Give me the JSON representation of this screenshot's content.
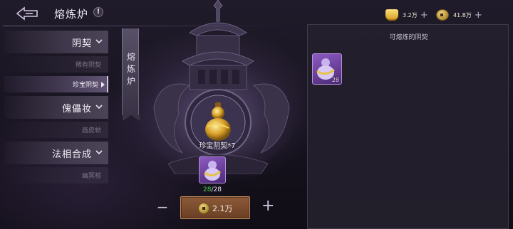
{
  "header": {
    "title": "熔炼炉",
    "info_mark": "!",
    "currencies": [
      {
        "icon": "gold-ingot-icon",
        "amount": "3.2万",
        "plus": "+"
      },
      {
        "icon": "copper-coin-icon",
        "amount": "41.8万",
        "plus": "+"
      }
    ]
  },
  "menu": {
    "categories": [
      {
        "label": "阴契",
        "subitems": [
          "稀有阴契",
          "珍宝阴契"
        ],
        "active_subitem": 1
      },
      {
        "label": "傀儡妆",
        "subitems": [
          "画皮帖"
        ]
      },
      {
        "label": "法相合成",
        "subitems": [
          "幽冥棺"
        ]
      }
    ]
  },
  "banner": {
    "text": "熔炼炉"
  },
  "center": {
    "item_name": "珍宝阴契*7",
    "have": "28",
    "need": "28",
    "sep": "/",
    "minus": "−",
    "plus": "+",
    "cost": "2.1万"
  },
  "panel": {
    "title": "可熔炼的阴契",
    "items": [
      {
        "icon": "purple-gourd-icon",
        "count": "28"
      }
    ]
  },
  "colors": {
    "accent_purple": "#8d5ac2",
    "green_count": "#48d04a",
    "button_brown": "#6a3f24",
    "gold": "#d49a20"
  }
}
